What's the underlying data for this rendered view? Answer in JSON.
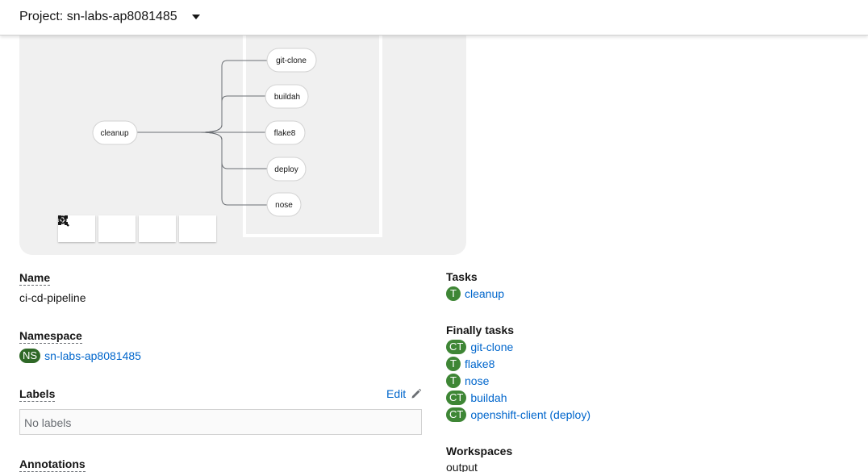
{
  "header": {
    "project_label": "Project: sn-labs-ap8081485"
  },
  "graph": {
    "nodes": {
      "cleanup": "cleanup",
      "git_clone": "git-clone",
      "buildah": "buildah",
      "flake8": "flake8",
      "deploy": "deploy",
      "nose": "nose"
    },
    "controls": [
      "zoom-in",
      "zoom-out",
      "fit-to-screen",
      "reset-view"
    ]
  },
  "details": {
    "name_label": "Name",
    "name_value": "ci-cd-pipeline",
    "namespace_label": "Namespace",
    "namespace_badge": "NS",
    "namespace_value": "sn-labs-ap8081485",
    "labels_label": "Labels",
    "edit_label": "Edit",
    "no_labels": "No labels",
    "annotations_label": "Annotations"
  },
  "tasks": {
    "tasks_label": "Tasks",
    "items": [
      {
        "badge": "T",
        "name": "cleanup"
      }
    ],
    "finally_label": "Finally tasks",
    "finally_items": [
      {
        "badge": "CT",
        "name": "git-clone"
      },
      {
        "badge": "T",
        "name": "flake8"
      },
      {
        "badge": "T",
        "name": "nose"
      },
      {
        "badge": "CT",
        "name": "buildah"
      },
      {
        "badge": "CT",
        "name": "openshift-client (deploy)"
      }
    ],
    "workspaces_label": "Workspaces",
    "workspaces_value": "output"
  },
  "colors": {
    "link": "#0066cc",
    "badge": "#3e8635",
    "panel": "#f0f0f0"
  }
}
